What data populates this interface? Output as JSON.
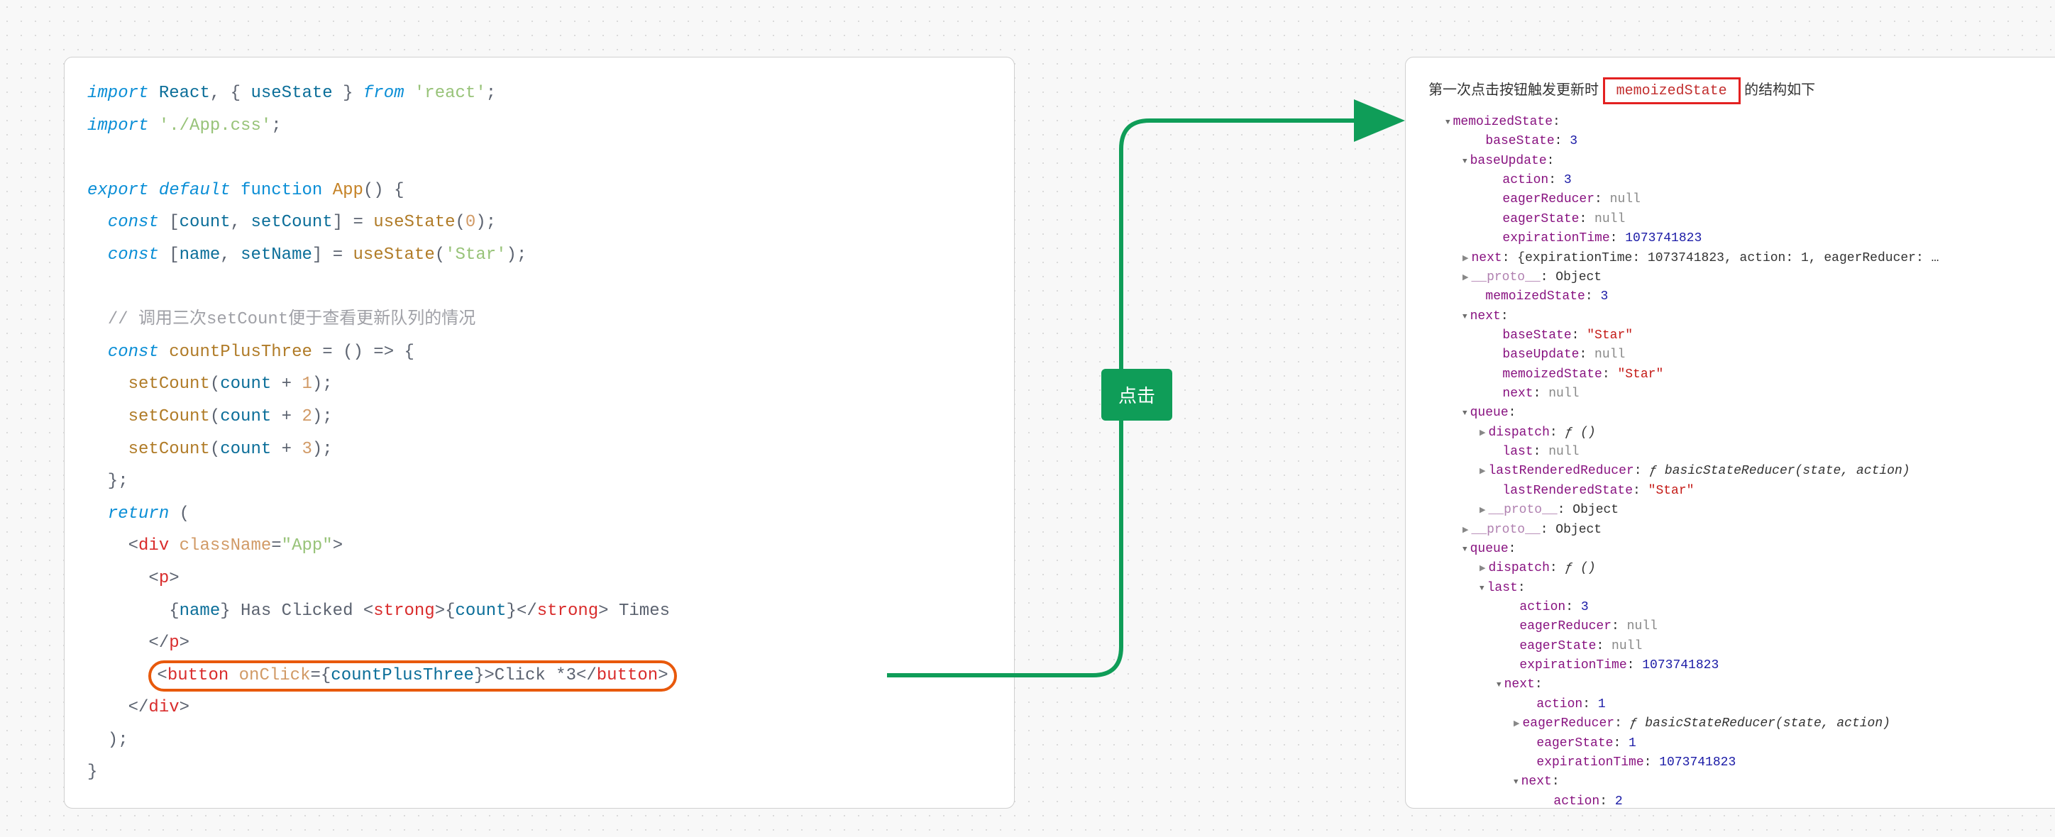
{
  "left": {
    "code_tokens": [
      [
        [
          "import",
          "c-key"
        ],
        [
          " ",
          "c-punc"
        ],
        [
          "React",
          "c-var"
        ],
        [
          ", { ",
          "c-punc"
        ],
        [
          "useState",
          "c-var"
        ],
        [
          " } ",
          "c-punc"
        ],
        [
          "from",
          "c-key"
        ],
        [
          " ",
          "c-punc"
        ],
        [
          "'react'",
          "c-str"
        ],
        [
          ";",
          "c-punc"
        ]
      ],
      [
        [
          "import",
          "c-key"
        ],
        [
          " ",
          "c-punc"
        ],
        [
          "'./App.css'",
          "c-str"
        ],
        [
          ";",
          "c-punc"
        ]
      ],
      [],
      [
        [
          "export",
          "c-key"
        ],
        [
          " ",
          "c-punc"
        ],
        [
          "default",
          "c-key"
        ],
        [
          " ",
          "c-punc"
        ],
        [
          "function",
          "c-key-plain"
        ],
        [
          " ",
          "c-punc"
        ],
        [
          "App",
          "c-type"
        ],
        [
          "() {",
          "c-punc"
        ]
      ],
      [
        [
          "  ",
          "c-punc"
        ],
        [
          "const",
          "c-key"
        ],
        [
          " [",
          "c-punc"
        ],
        [
          "count",
          "c-var"
        ],
        [
          ", ",
          "c-punc"
        ],
        [
          "setCount",
          "c-var"
        ],
        [
          "] = ",
          "c-punc"
        ],
        [
          "useState",
          "c-fn"
        ],
        [
          "(",
          "c-punc"
        ],
        [
          "0",
          "c-num"
        ],
        [
          ");",
          "c-punc"
        ]
      ],
      [
        [
          "  ",
          "c-punc"
        ],
        [
          "const",
          "c-key"
        ],
        [
          " [",
          "c-punc"
        ],
        [
          "name",
          "c-var"
        ],
        [
          ", ",
          "c-punc"
        ],
        [
          "setName",
          "c-var"
        ],
        [
          "] = ",
          "c-punc"
        ],
        [
          "useState",
          "c-fn"
        ],
        [
          "(",
          "c-punc"
        ],
        [
          "'Star'",
          "c-str"
        ],
        [
          ");",
          "c-punc"
        ]
      ],
      [],
      [
        [
          "  ",
          "c-punc"
        ],
        [
          "// 调用三次setCount便于查看更新队列的情况",
          "c-comment"
        ]
      ],
      [
        [
          "  ",
          "c-punc"
        ],
        [
          "const",
          "c-key"
        ],
        [
          " ",
          "c-punc"
        ],
        [
          "countPlusThree",
          "c-fn"
        ],
        [
          " = () => {",
          "c-punc"
        ]
      ],
      [
        [
          "    ",
          "c-punc"
        ],
        [
          "setCount",
          "c-fn"
        ],
        [
          "(",
          "c-punc"
        ],
        [
          "count",
          "c-var"
        ],
        [
          " + ",
          "c-punc"
        ],
        [
          "1",
          "c-num"
        ],
        [
          ");",
          "c-punc"
        ]
      ],
      [
        [
          "    ",
          "c-punc"
        ],
        [
          "setCount",
          "c-fn"
        ],
        [
          "(",
          "c-punc"
        ],
        [
          "count",
          "c-var"
        ],
        [
          " + ",
          "c-punc"
        ],
        [
          "2",
          "c-num"
        ],
        [
          ");",
          "c-punc"
        ]
      ],
      [
        [
          "    ",
          "c-punc"
        ],
        [
          "setCount",
          "c-fn"
        ],
        [
          "(",
          "c-punc"
        ],
        [
          "count",
          "c-var"
        ],
        [
          " + ",
          "c-punc"
        ],
        [
          "3",
          "c-num"
        ],
        [
          ");",
          "c-punc"
        ]
      ],
      [
        [
          "  };",
          "c-punc"
        ]
      ],
      [
        [
          "  ",
          "c-punc"
        ],
        [
          "return",
          "c-key"
        ],
        [
          " (",
          "c-punc"
        ]
      ],
      [
        [
          "    <",
          "c-punc"
        ],
        [
          "div",
          "c-tag"
        ],
        [
          " ",
          "c-punc"
        ],
        [
          "className",
          "c-attr"
        ],
        [
          "=",
          "c-punc"
        ],
        [
          "\"App\"",
          "c-str"
        ],
        [
          ">",
          "c-punc"
        ]
      ],
      [
        [
          "      <",
          "c-punc"
        ],
        [
          "p",
          "c-tag"
        ],
        [
          ">",
          "c-punc"
        ]
      ],
      [
        [
          "        {",
          "c-brace"
        ],
        [
          "name",
          "c-var"
        ],
        [
          "}",
          "c-brace"
        ],
        [
          " Has Clicked ",
          "c-punc"
        ],
        [
          "<",
          "c-punc"
        ],
        [
          "strong",
          "c-tag"
        ],
        [
          ">",
          "c-punc"
        ],
        [
          "{",
          "c-brace"
        ],
        [
          "count",
          "c-var"
        ],
        [
          "}",
          "c-brace"
        ],
        [
          "</",
          "c-punc"
        ],
        [
          "strong",
          "c-tag"
        ],
        [
          ">",
          "c-punc"
        ],
        [
          " Times",
          "c-punc"
        ]
      ],
      [
        [
          "      </",
          "c-punc"
        ],
        [
          "p",
          "c-tag"
        ],
        [
          ">",
          "c-punc"
        ]
      ],
      [
        [
          "HL",
          "HL"
        ]
      ],
      [
        [
          "    </",
          "c-punc"
        ],
        [
          "div",
          "c-tag"
        ],
        [
          ">",
          "c-punc"
        ]
      ],
      [
        [
          "  );",
          "c-punc"
        ]
      ],
      [
        [
          "}",
          "c-punc"
        ]
      ]
    ],
    "highlight_tokens": [
      [
        "<",
        "c-punc"
      ],
      [
        "button",
        "c-tag"
      ],
      [
        " ",
        "c-punc"
      ],
      [
        "onClick",
        "c-attr"
      ],
      [
        "=",
        "c-punc"
      ],
      [
        "{",
        "c-brace"
      ],
      [
        "countPlusThree",
        "c-var"
      ],
      [
        "}",
        "c-brace"
      ],
      [
        ">",
        "c-punc"
      ],
      [
        "Click *3",
        "c-punc"
      ],
      [
        "</",
        "c-punc"
      ],
      [
        "button",
        "c-tag"
      ],
      [
        ">",
        "c-punc"
      ]
    ]
  },
  "connector_label": "点击",
  "right": {
    "header_prefix": "第一次点击按钮触发更新时",
    "header_boxed": "memoizedState",
    "header_suffix": "的结构如下",
    "tree": [
      {
        "indent": 1,
        "arrow": "down",
        "key": "memoizedState",
        "suffix": ":"
      },
      {
        "indent": 2,
        "arrow": "",
        "key": "baseState",
        "suffix": ": ",
        "val": "3",
        "vcls": "t-num"
      },
      {
        "indent": 2,
        "arrow": "down",
        "key": "baseUpdate",
        "suffix": ":"
      },
      {
        "indent": 3,
        "arrow": "",
        "key": "action",
        "suffix": ": ",
        "val": "3",
        "vcls": "t-num"
      },
      {
        "indent": 3,
        "arrow": "",
        "key": "eagerReducer",
        "suffix": ": ",
        "val": "null",
        "vcls": "t-null"
      },
      {
        "indent": 3,
        "arrow": "",
        "key": "eagerState",
        "suffix": ": ",
        "val": "null",
        "vcls": "t-null"
      },
      {
        "indent": 3,
        "arrow": "",
        "key": "expirationTime",
        "suffix": ": ",
        "val": "1073741823",
        "vcls": "t-num"
      },
      {
        "indent": 2,
        "arrow": "right",
        "key": "next",
        "suffix": ": ",
        "val": "{expirationTime: 1073741823, action: 1, eagerReducer: …",
        "vcls": "t-obj"
      },
      {
        "indent": 2,
        "arrow": "right",
        "key": "__proto__",
        "keycls": "t-proto",
        "suffix": ": ",
        "val": "Object",
        "vcls": "t-obj"
      },
      {
        "indent": 2,
        "arrow": "",
        "key": "memoizedState",
        "suffix": ": ",
        "val": "3",
        "vcls": "t-num"
      },
      {
        "indent": 2,
        "arrow": "down",
        "key": "next",
        "suffix": ":"
      },
      {
        "indent": 3,
        "arrow": "",
        "key": "baseState",
        "suffix": ": ",
        "val": "\"Star\"",
        "vcls": "t-str"
      },
      {
        "indent": 3,
        "arrow": "",
        "key": "baseUpdate",
        "suffix": ": ",
        "val": "null",
        "vcls": "t-null"
      },
      {
        "indent": 3,
        "arrow": "",
        "key": "memoizedState",
        "suffix": ": ",
        "val": "\"Star\"",
        "vcls": "t-str"
      },
      {
        "indent": 3,
        "arrow": "",
        "key": "next",
        "suffix": ": ",
        "val": "null",
        "vcls": "t-null"
      },
      {
        "indent": 2,
        "arrow": "down",
        "key": "queue",
        "suffix": ":"
      },
      {
        "indent": 3,
        "arrow": "right",
        "key": "dispatch",
        "suffix": ": ",
        "val": "ƒ ()",
        "vcls": "t-fn"
      },
      {
        "indent": 3,
        "arrow": "",
        "key": "last",
        "suffix": ": ",
        "val": "null",
        "vcls": "t-null"
      },
      {
        "indent": 3,
        "arrow": "right",
        "key": "lastRenderedReducer",
        "suffix": ": ",
        "val": "ƒ basicStateReducer(state, action)",
        "vcls": "t-fn"
      },
      {
        "indent": 3,
        "arrow": "",
        "key": "lastRenderedState",
        "suffix": ": ",
        "val": "\"Star\"",
        "vcls": "t-str"
      },
      {
        "indent": 3,
        "arrow": "right",
        "key": "__proto__",
        "keycls": "t-proto",
        "suffix": ": ",
        "val": "Object",
        "vcls": "t-obj"
      },
      {
        "indent": 2,
        "arrow": "right",
        "key": "__proto__",
        "keycls": "t-proto",
        "suffix": ": ",
        "val": "Object",
        "vcls": "t-obj"
      },
      {
        "indent": 2,
        "arrow": "down",
        "key": "queue",
        "suffix": ":"
      },
      {
        "indent": 3,
        "arrow": "right",
        "key": "dispatch",
        "suffix": ": ",
        "val": "ƒ ()",
        "vcls": "t-fn"
      },
      {
        "indent": 3,
        "arrow": "down",
        "key": "last",
        "suffix": ":"
      },
      {
        "indent": 4,
        "arrow": "",
        "key": "action",
        "suffix": ": ",
        "val": "3",
        "vcls": "t-num"
      },
      {
        "indent": 4,
        "arrow": "",
        "key": "eagerReducer",
        "suffix": ": ",
        "val": "null",
        "vcls": "t-null"
      },
      {
        "indent": 4,
        "arrow": "",
        "key": "eagerState",
        "suffix": ": ",
        "val": "null",
        "vcls": "t-null"
      },
      {
        "indent": 4,
        "arrow": "",
        "key": "expirationTime",
        "suffix": ": ",
        "val": "1073741823",
        "vcls": "t-num"
      },
      {
        "indent": 4,
        "arrow": "down",
        "key": "next",
        "suffix": ":"
      },
      {
        "indent": 5,
        "arrow": "",
        "key": "action",
        "suffix": ": ",
        "val": "1",
        "vcls": "t-num"
      },
      {
        "indent": 5,
        "arrow": "right",
        "key": "eagerReducer",
        "suffix": ": ",
        "val": "ƒ basicStateReducer(state, action)",
        "vcls": "t-fn"
      },
      {
        "indent": 5,
        "arrow": "",
        "key": "eagerState",
        "suffix": ": ",
        "val": "1",
        "vcls": "t-num"
      },
      {
        "indent": 5,
        "arrow": "",
        "key": "expirationTime",
        "suffix": ": ",
        "val": "1073741823",
        "vcls": "t-num"
      },
      {
        "indent": 5,
        "arrow": "down",
        "key": "next",
        "suffix": ":"
      },
      {
        "indent": 6,
        "arrow": "",
        "key": "action",
        "suffix": ": ",
        "val": "2",
        "vcls": "t-num"
      }
    ]
  }
}
